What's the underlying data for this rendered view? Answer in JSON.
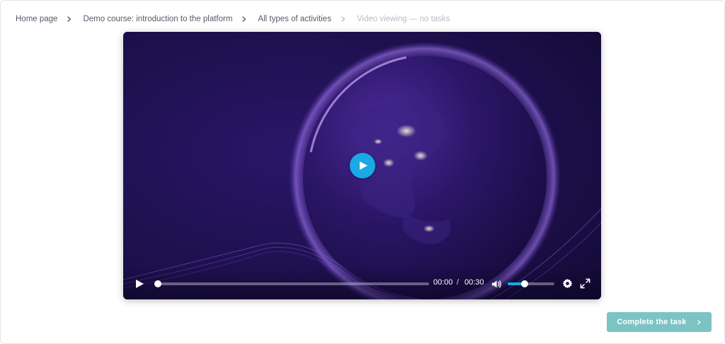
{
  "breadcrumb": {
    "items": [
      "Home page",
      "Demo course: introduction to the platform",
      "All types of activities"
    ],
    "current": "Video viewing — no tasks"
  },
  "player": {
    "current_time": "00:00",
    "separator": "/",
    "duration": "00:30",
    "progress_percent": 0,
    "volume_percent": 37,
    "play_icon": "play-icon",
    "volume_icon": "volume-icon",
    "settings_icon": "gear-icon",
    "fullscreen_icon": "fullscreen-icon",
    "accent_color": "#19a9e5"
  },
  "actions": {
    "complete_label": "Complete the task",
    "complete_color": "#7cc3c4"
  }
}
